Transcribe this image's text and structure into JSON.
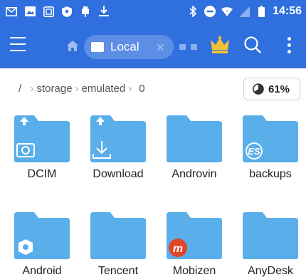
{
  "status_bar": {
    "time": "14:56",
    "left_icons": [
      "gmail-icon",
      "image-icon",
      "app-icon",
      "shield-icon",
      "usb-icon",
      "download-icon"
    ],
    "right_icons": [
      "bluetooth-icon",
      "dnd-icon",
      "wifi-icon",
      "signal-icon",
      "battery-icon"
    ]
  },
  "app_bar": {
    "tab_label": "Local",
    "icons": [
      "menu-icon",
      "home-icon",
      "sd-card-icon",
      "close-icon",
      "crown-icon",
      "search-icon",
      "more-vert-icon"
    ]
  },
  "path": {
    "root": "/",
    "segments": [
      "storage",
      "emulated",
      "0"
    ]
  },
  "storage_badge": {
    "text": "61%",
    "percent": 61
  },
  "folders": [
    {
      "label": "DCIM",
      "overlay": "camera-icon",
      "marker": "upload-arrow-icon"
    },
    {
      "label": "Download",
      "overlay": "download-icon",
      "marker": "upload-arrow-icon"
    },
    {
      "label": "Androvin",
      "overlay": "",
      "marker": ""
    },
    {
      "label": "backups",
      "overlay": "es-logo-icon",
      "marker": ""
    },
    {
      "label": "Android",
      "overlay": "gear-icon",
      "marker": ""
    },
    {
      "label": "Tencent",
      "overlay": "",
      "marker": ""
    },
    {
      "label": "Mobizen",
      "overlay": "mobizen-logo-icon",
      "marker": ""
    },
    {
      "label": "AnyDesk",
      "overlay": "",
      "marker": ""
    }
  ],
  "colors": {
    "primary": "#2f6fde",
    "folder": "#5aaeea",
    "folder_tab": "#79c0f0",
    "mobizen": "#e0452a",
    "crown": "#f3c233"
  }
}
